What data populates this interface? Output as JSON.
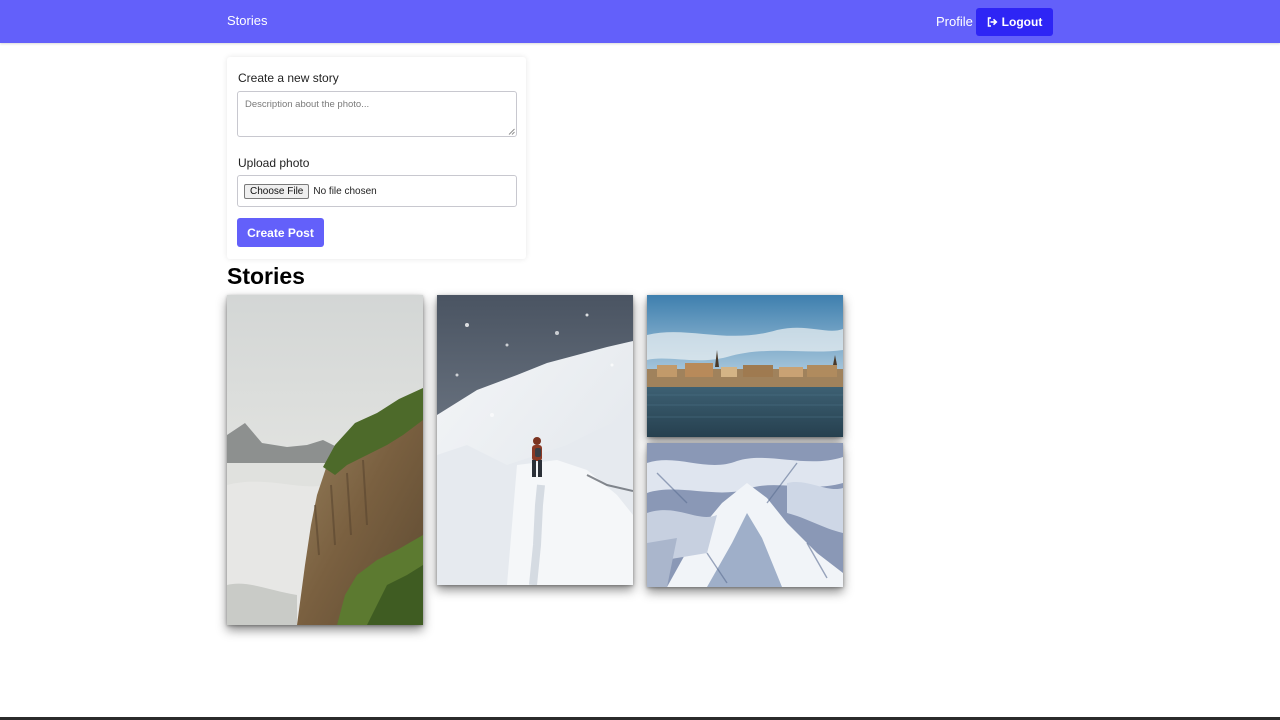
{
  "nav": {
    "brand": "Stories",
    "profile": "Profile",
    "logout": "Logout"
  },
  "form": {
    "title": "Create a new story",
    "description_placeholder": "Description about the photo...",
    "upload_label": "Upload photo",
    "choose_file": "Choose File",
    "no_file": "No file chosen",
    "submit": "Create Post"
  },
  "stories": {
    "heading": "Stories"
  },
  "colors": {
    "navbar": "#6360fa",
    "logout_button": "#2e25f5",
    "primary_button": "#6360fa"
  }
}
